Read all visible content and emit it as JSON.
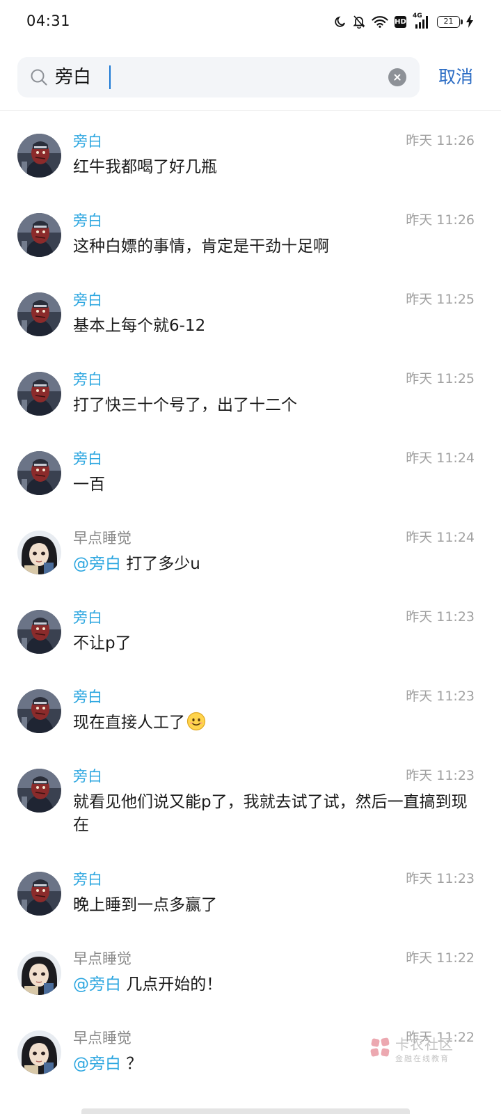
{
  "status_bar": {
    "time": "04:31",
    "network_tag": "4G",
    "hd_label": "HD",
    "battery_level": "21"
  },
  "search": {
    "query": "旁白",
    "cancel_label": "取消"
  },
  "results": [
    {
      "name": "旁白",
      "time": "昨天 11:26",
      "message": "红牛我都喝了好几瓶"
    },
    {
      "name": "旁白",
      "time": "昨天 11:26",
      "message": "这种白嫖的事情，肯定是干劲十足啊"
    },
    {
      "name": "旁白",
      "time": "昨天 11:25",
      "message": "基本上每个就6-12"
    },
    {
      "name": "旁白",
      "time": "昨天 11:25",
      "message": "打了快三十个号了，出了十二个"
    },
    {
      "name": "旁白",
      "time": "昨天 11:24",
      "message": "一百"
    },
    {
      "name": "早点睡觉",
      "time": "昨天 11:24",
      "mention": "@旁白",
      "message": " 打了多少u"
    },
    {
      "name": "旁白",
      "time": "昨天 11:23",
      "message": "不让p了"
    },
    {
      "name": "旁白",
      "time": "昨天 11:23",
      "message": "现在直接人工了"
    },
    {
      "name": "旁白",
      "time": "昨天 11:23",
      "message": "就看见他们说又能p了，我就去试了试，然后一直搞到现在"
    },
    {
      "name": "旁白",
      "time": "昨天 11:23",
      "message": "晚上睡到一点多赢了"
    },
    {
      "name": "早点睡觉",
      "time": "昨天 11:22",
      "mention": "@旁白",
      "message": " 几点开始的！"
    },
    {
      "name": "早点睡觉",
      "time": "昨天 11:22",
      "mention": "@旁白",
      "message": " ？"
    }
  ],
  "watermark": {
    "title": "卡农社区",
    "subtitle": "金融在线教育"
  },
  "icons": {
    "search": "search-icon",
    "clear": "clear-icon",
    "moon": "moon-icon",
    "mute": "bell-off-icon",
    "wifi": "wifi-icon",
    "signal": "signal-icon",
    "charging": "charging-icon",
    "emoji": "smile-emoji-icon"
  },
  "colors": {
    "accent_name": "#2ea7e0",
    "cancel": "#2b6cc4",
    "secondary": "#8a8a8a"
  }
}
